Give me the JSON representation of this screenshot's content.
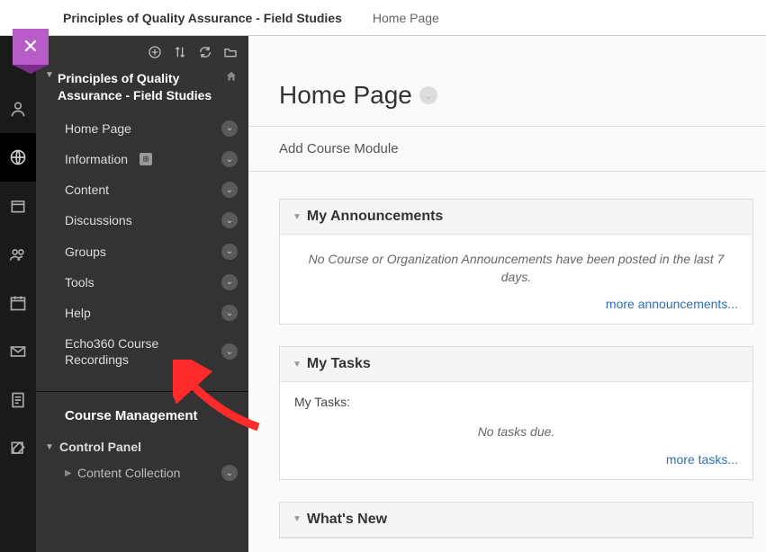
{
  "topbar": {
    "course_title": "Principles of Quality Assurance - Field Studies",
    "page_name": "Home Page"
  },
  "close_icon": "✕",
  "sidebar": {
    "toolbar": {
      "add": "⊕",
      "reorder": "↕",
      "refresh": "⟳",
      "folder": "🗀"
    },
    "course_title": "Principles of Quality Assurance - Field Studies",
    "items": [
      {
        "label": "Home Page"
      },
      {
        "label": "Information",
        "badge": "⊞"
      },
      {
        "label": "Content"
      },
      {
        "label": "Discussions"
      },
      {
        "label": "Groups"
      },
      {
        "label": "Tools"
      },
      {
        "label": "Help"
      },
      {
        "label": "Echo360 Course Recordings"
      }
    ],
    "course_management": "Course Management",
    "control_panel": "Control Panel",
    "content_collection": "Content Collection"
  },
  "main": {
    "page_title": "Home Page",
    "add_module": "Add Course Module",
    "announcements": {
      "title": "My Announcements",
      "empty": "No Course or Organization Announcements have been posted in the last 7 days.",
      "more": "more announcements..."
    },
    "tasks": {
      "title": "My Tasks",
      "sub": "My Tasks:",
      "empty": "No tasks due.",
      "more": "more tasks..."
    },
    "whats_new": {
      "title": "What's New"
    }
  }
}
